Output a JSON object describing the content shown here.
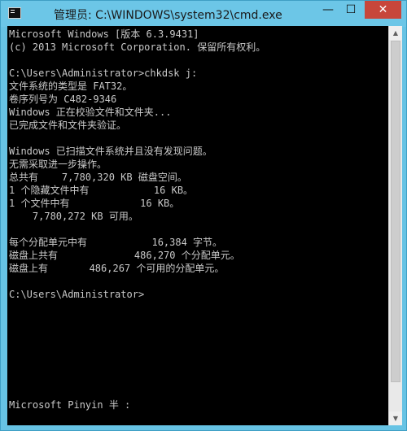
{
  "window": {
    "title": "管理员: C:\\WINDOWS\\system32\\cmd.exe",
    "icon": "cmd-icon",
    "buttons": {
      "minimize": "—",
      "maximize": "☐",
      "close": "✕"
    }
  },
  "console": {
    "lines": [
      "Microsoft Windows [版本 6.3.9431]",
      "(c) 2013 Microsoft Corporation. 保留所有权利。",
      "",
      "C:\\Users\\Administrator>chkdsk j:",
      "文件系统的类型是 FAT32。",
      "卷序列号为 C482-9346",
      "Windows 正在校验文件和文件夹...",
      "已完成文件和文件夹验证。",
      "",
      "Windows 已扫描文件系统并且没有发现问题。",
      "无需采取进一步操作。",
      "总共有    7,780,320 KB 磁盘空间。",
      "1 个隐藏文件中有           16 KB。",
      "1 个文件中有            16 KB。",
      "    7,780,272 KB 可用。",
      "",
      "每个分配单元中有           16,384 字节。",
      "磁盘上共有             486,270 个分配单元。",
      "磁盘上有       486,267 个可用的分配单元。",
      "",
      "C:\\Users\\Administrator>"
    ],
    "ime_status": "Microsoft Pinyin 半 :"
  },
  "scrollbar": {
    "up_arrow": "▲",
    "down_arrow": "▼"
  },
  "colors": {
    "titlebar": "#6cc6e7",
    "console_bg": "#000000",
    "console_text": "#c9c9c9",
    "close_button": "#c7463b"
  }
}
